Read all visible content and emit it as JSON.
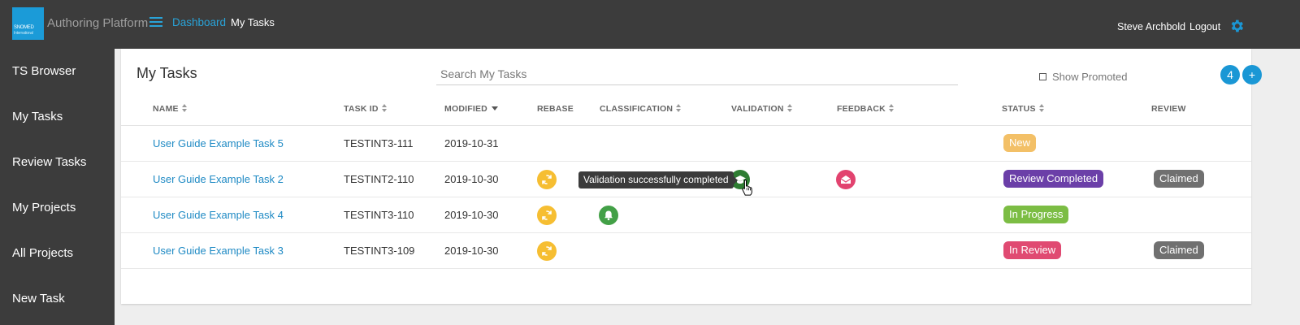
{
  "colors": {
    "topbar": "#3c3c3c",
    "accent": "#1a97d5",
    "link": "#1f8ac4",
    "rebase": "#f6be32",
    "validation": "#2e7d32",
    "classification": "#43a047",
    "feedback": "#e2436f",
    "status_new": "#f3c067",
    "status_review_completed": "#6b3fa8",
    "status_in_progress": "#7cbd44",
    "status_in_review": "#e04a72",
    "claimed": "#707070"
  },
  "header": {
    "logo_line1": "SNOMED",
    "logo_line2": "International",
    "app_title": "Authoring Platform",
    "nav_dashboard": "Dashboard",
    "nav_mytasks": "My Tasks",
    "user_name": "Steve Archbold",
    "logout": "Logout",
    "menu_icon": "hamburger-icon",
    "settings_icon": "gear-icon"
  },
  "sidebar": {
    "items": [
      {
        "label": "TS Browser"
      },
      {
        "label": "My Tasks"
      },
      {
        "label": "Review Tasks"
      },
      {
        "label": "My Projects"
      },
      {
        "label": "All Projects"
      },
      {
        "label": "New Task"
      }
    ]
  },
  "main": {
    "title": "My Tasks",
    "search_placeholder": "Search My Tasks",
    "show_promoted": "Show Promoted",
    "count": "4",
    "add_label": "+",
    "columns": {
      "name": "NAME",
      "task_id": "TASK ID",
      "modified": "MODIFIED",
      "rebase": "REBASE",
      "classification": "CLASSIFICATION",
      "validation": "VALIDATION",
      "feedback": "FEEDBACK",
      "status": "STATUS",
      "review": "REVIEW"
    },
    "rows": [
      {
        "name": "User Guide Example Task 5",
        "task_id": "TESTINT3-111",
        "modified": "2019-10-31",
        "status": "New",
        "review": ""
      },
      {
        "name": "User Guide Example Task 2",
        "task_id": "TESTINT2-110",
        "modified": "2019-10-30",
        "status": "Review Completed",
        "review": "Claimed"
      },
      {
        "name": "User Guide Example Task 4",
        "task_id": "TESTINT3-110",
        "modified": "2019-10-30",
        "status": "In Progress",
        "review": ""
      },
      {
        "name": "User Guide Example Task 3",
        "task_id": "TESTINT3-109",
        "modified": "2019-10-30",
        "status": "In Review",
        "review": "Claimed"
      }
    ],
    "tooltip": "Validation successfully completed"
  }
}
